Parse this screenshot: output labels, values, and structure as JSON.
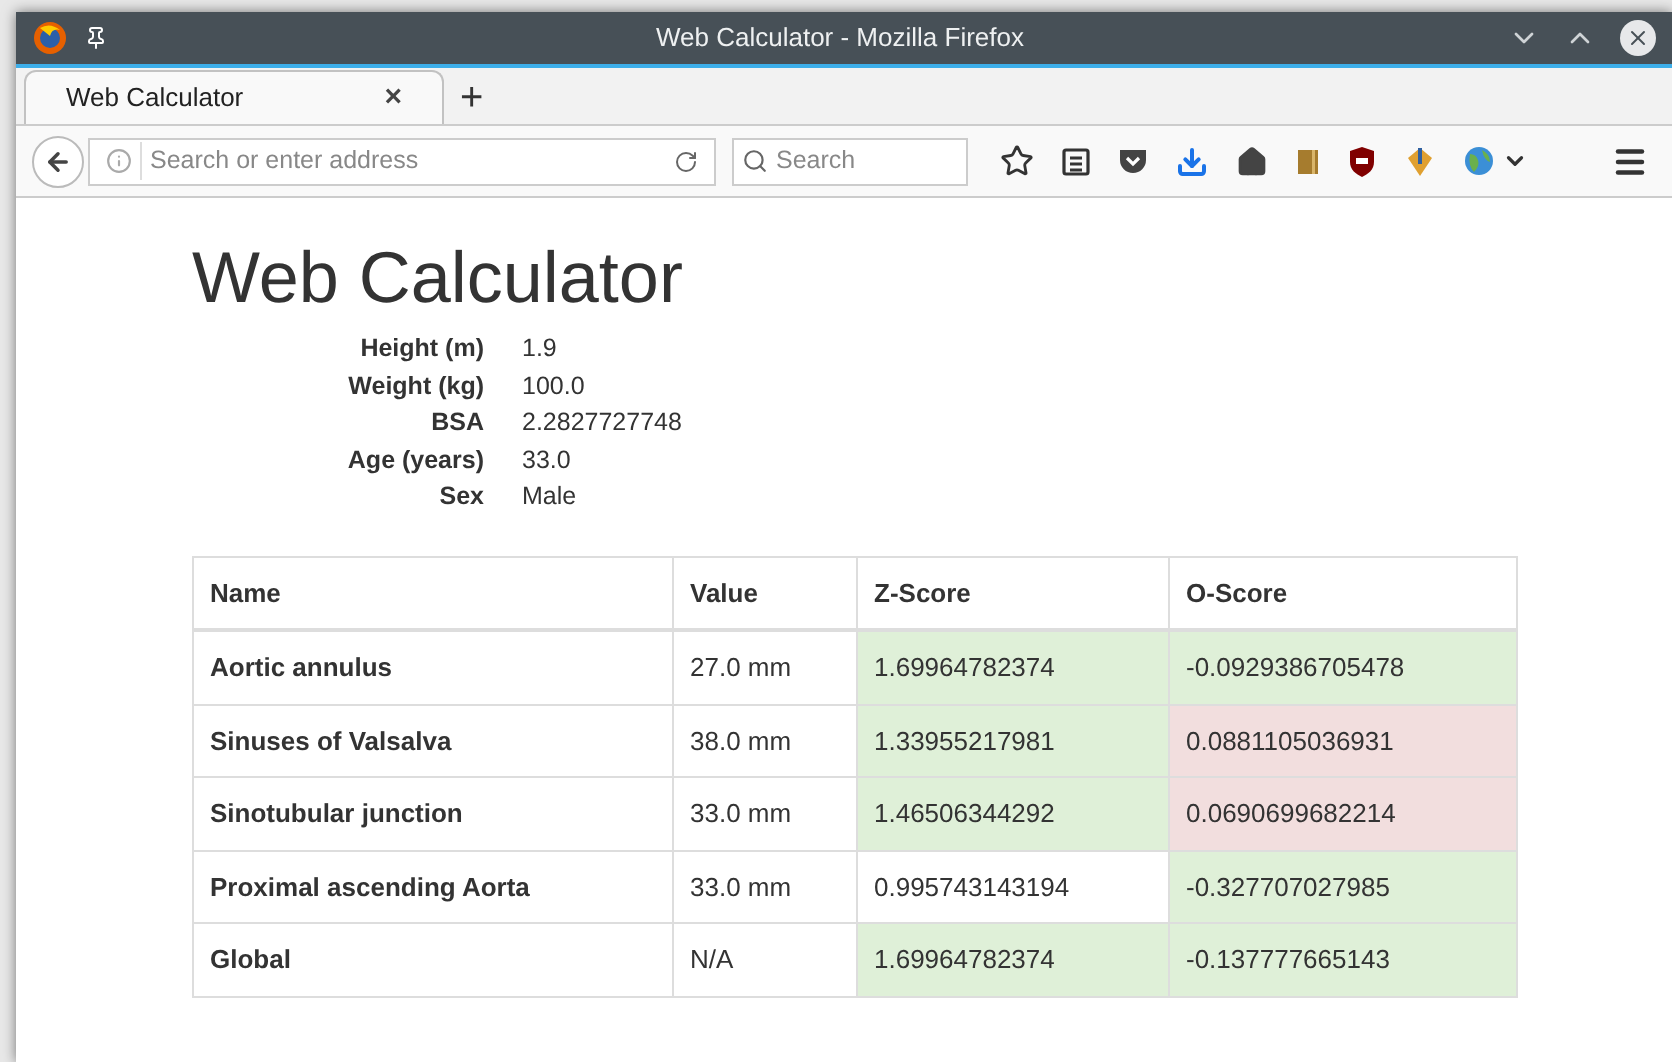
{
  "window": {
    "title": "Web Calculator - Mozilla Firefox"
  },
  "tabs": [
    {
      "label": "Web Calculator",
      "selected": true,
      "close": "×"
    }
  ],
  "new_tab": "+",
  "address_bar": {
    "placeholder": "Search or enter address"
  },
  "search_field": {
    "placeholder": "Search"
  },
  "page": {
    "heading": "Web Calculator",
    "details": [
      {
        "label": "Height (m)",
        "value": "1.9"
      },
      {
        "label": "Weight (kg)",
        "value": "100.0"
      },
      {
        "label": "BSA",
        "value": "2.2827727748"
      },
      {
        "label": "Age (years)",
        "value": "33.0"
      },
      {
        "label": "Sex",
        "value": "Male"
      }
    ],
    "table": {
      "columns": [
        "Name",
        "Value",
        "Z-Score",
        "O-Score"
      ],
      "rows": [
        {
          "name": "Aortic annulus",
          "value": "27.0 mm",
          "z": {
            "text": "1.69964782374",
            "kind": "success"
          },
          "o": {
            "text": "-0.0929386705478",
            "kind": "success"
          }
        },
        {
          "name": "Sinuses of Valsalva",
          "value": "38.0 mm",
          "z": {
            "text": "1.33955217981",
            "kind": "success"
          },
          "o": {
            "text": "0.0881105036931",
            "kind": "danger"
          }
        },
        {
          "name": "Sinotubular junction",
          "value": "33.0 mm",
          "z": {
            "text": "1.46506344292",
            "kind": "success"
          },
          "o": {
            "text": "0.0690699682214",
            "kind": "danger"
          }
        },
        {
          "name": "Proximal ascending Aorta",
          "value": "33.0 mm",
          "z": {
            "text": "0.995743143194",
            "kind": "plain"
          },
          "o": {
            "text": "-0.327707027985",
            "kind": "success"
          }
        },
        {
          "name": "Global",
          "value": "N/A",
          "z": {
            "text": "1.69964782374",
            "kind": "success"
          },
          "o": {
            "text": "-0.137777665143",
            "kind": "success"
          }
        }
      ]
    }
  }
}
